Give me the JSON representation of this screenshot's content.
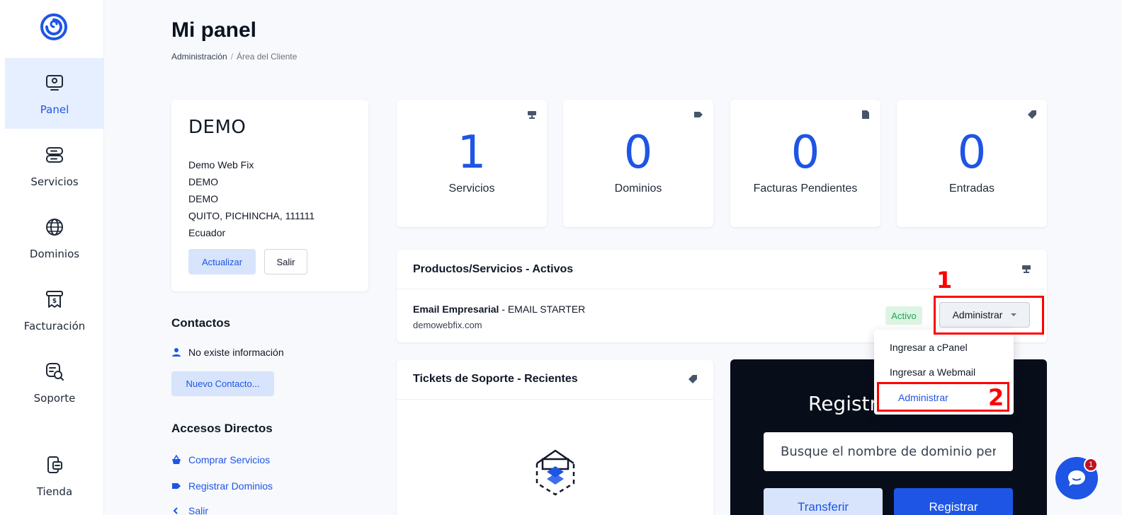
{
  "sidebar": {
    "items": [
      {
        "label": "Panel",
        "icon": "dashboard-icon"
      },
      {
        "label": "Servicios",
        "icon": "server-icon"
      },
      {
        "label": "Dominios",
        "icon": "globe-icon"
      },
      {
        "label": "Facturación",
        "icon": "invoice-icon"
      },
      {
        "label": "Soporte",
        "icon": "support-icon"
      },
      {
        "label": "Tienda",
        "icon": "store-icon"
      }
    ]
  },
  "header": {
    "title": "Mi panel",
    "breadcrumb": [
      "Administración",
      "Área del Cliente"
    ]
  },
  "client": {
    "name": "DEMO",
    "address": [
      "Demo Web Fix",
      "DEMO",
      "DEMO",
      "QUITO, PICHINCHA, 111111",
      "Ecuador"
    ],
    "update_label": "Actualizar",
    "logout_label": "Salir"
  },
  "contacts": {
    "title": "Contactos",
    "empty_text": "No existe información",
    "new_label": "Nuevo Contacto..."
  },
  "shortcuts": {
    "title": "Accesos Directos",
    "items": [
      "Comprar Servicios",
      "Registrar Dominios",
      "Salir"
    ]
  },
  "stats": [
    {
      "value": "1",
      "label": "Servicios",
      "icon": "server-icon"
    },
    {
      "value": "0",
      "label": "Dominios",
      "icon": "tag-icon"
    },
    {
      "value": "0",
      "label": "Facturas Pendientes",
      "icon": "document-icon"
    },
    {
      "value": "0",
      "label": "Entradas",
      "icon": "ticket-icon"
    }
  ],
  "products": {
    "title": "Productos/Servicios - Activos",
    "item": {
      "name": "Email Empresarial",
      "plan": " - EMAIL STARTER",
      "domain": "demowebfix.com",
      "status": "Activo",
      "action_label": "Administrar"
    }
  },
  "dropdown": {
    "items": [
      "Ingresar a cPanel",
      "Ingresar a Webmail",
      "Administrar"
    ]
  },
  "tickets": {
    "title": "Tickets de Soporte - Recientes"
  },
  "domain": {
    "title": "Registra",
    "placeholder": "Busque el nombre de dominio perfecto...",
    "transfer_label": "Transferir",
    "register_label": "Registrar"
  },
  "annotations": [
    "1",
    "2"
  ],
  "chat": {
    "badge": "1"
  },
  "colors": {
    "accent": "#1e55e5",
    "accent_light": "#d7e4fb",
    "success": "#22a05b",
    "annotation": "#ff0000",
    "dark_panel": "#080d1a"
  }
}
